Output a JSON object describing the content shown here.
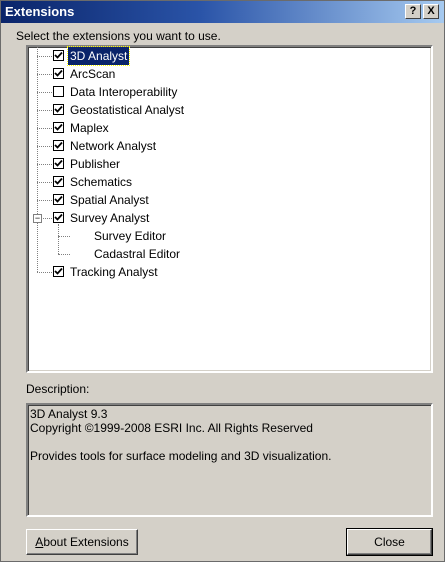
{
  "window": {
    "title": "Extensions",
    "help_button": "?",
    "close_button": "X"
  },
  "prompt": "Select the extensions you want to use.",
  "extensions": [
    {
      "label": "3D Analyst",
      "checked": true,
      "selected": true
    },
    {
      "label": "ArcScan",
      "checked": true
    },
    {
      "label": "Data Interoperability",
      "checked": false
    },
    {
      "label": "Geostatistical Analyst",
      "checked": true
    },
    {
      "label": "Maplex",
      "checked": true
    },
    {
      "label": "Network Analyst",
      "checked": true
    },
    {
      "label": "Publisher",
      "checked": true
    },
    {
      "label": "Schematics",
      "checked": true
    },
    {
      "label": "Spatial Analyst",
      "checked": true
    },
    {
      "label": "Survey Analyst",
      "checked": true,
      "expanded": true,
      "expander": "−",
      "children": [
        "Survey Editor",
        "Cadastral Editor"
      ]
    },
    {
      "label": "Tracking Analyst",
      "checked": true
    }
  ],
  "description": {
    "label": "Description:",
    "text": "3D Analyst 9.3\nCopyright ©1999-2008 ESRI Inc. All Rights Reserved\n\nProvides tools for surface modeling and 3D visualization."
  },
  "buttons": {
    "about_mnemonic": "A",
    "about_rest": "bout Extensions",
    "close": "Close"
  },
  "colors": {
    "title_start": "#0a246a",
    "title_end": "#a6caf0",
    "dialog_bg": "#d4d0c8",
    "selection": "#0a246a"
  }
}
